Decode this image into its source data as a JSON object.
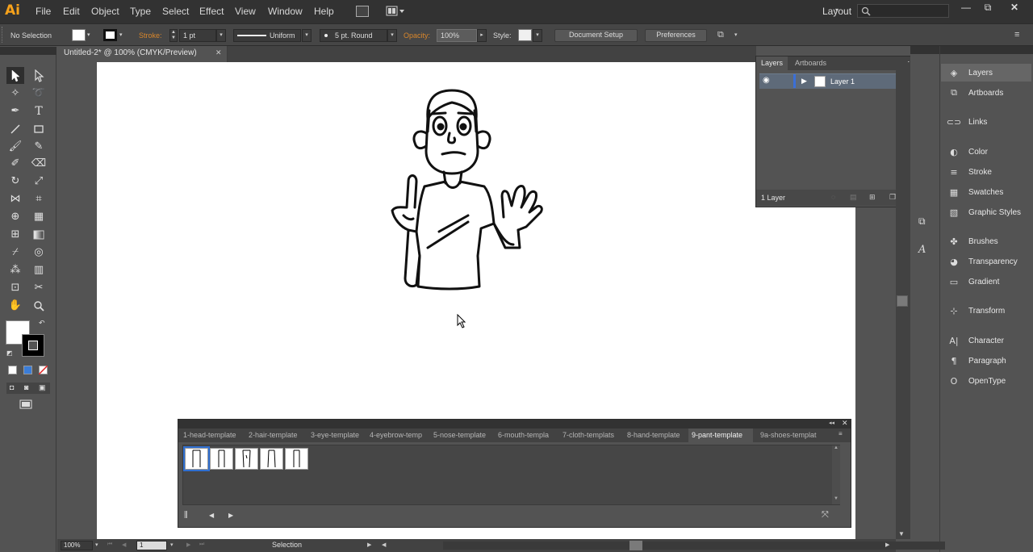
{
  "app": {
    "logo": "Ai"
  },
  "menu": [
    "File",
    "Edit",
    "Object",
    "Type",
    "Select",
    "Effect",
    "View",
    "Window",
    "Help"
  ],
  "workspace": {
    "label": "Layout",
    "search_placeholder": ""
  },
  "control_bar": {
    "selection": "No Selection",
    "stroke_label": "Stroke:",
    "stroke_weight": "1 pt",
    "profile": "Uniform",
    "brush": "5 pt. Round",
    "opacity_label": "Opacity:",
    "opacity": "100%",
    "style_label": "Style:",
    "document_setup": "Document Setup",
    "preferences": "Preferences"
  },
  "document": {
    "tab_title": "Untitled-2* @ 100% (CMYK/Preview)"
  },
  "layers_panel": {
    "tabs": [
      "Layers",
      "Artboards"
    ],
    "active_tab": "Layers",
    "layers": [
      {
        "name": "Layer 1"
      }
    ],
    "count_label": "1 Layer"
  },
  "dock": {
    "items": [
      {
        "label": "Layers",
        "icon": "layers-icon",
        "active": true
      },
      {
        "label": "Artboards",
        "icon": "artboards-icon"
      },
      {
        "label": "Links",
        "icon": "links-icon"
      },
      {
        "label": "Color",
        "icon": "color-icon"
      },
      {
        "label": "Stroke",
        "icon": "stroke-icon"
      },
      {
        "label": "Swatches",
        "icon": "swatches-icon"
      },
      {
        "label": "Graphic Styles",
        "icon": "graphic-styles-icon"
      },
      {
        "label": "Brushes",
        "icon": "brushes-icon"
      },
      {
        "label": "Transparency",
        "icon": "transparency-icon"
      },
      {
        "label": "Gradient",
        "icon": "gradient-icon"
      },
      {
        "label": "Transform",
        "icon": "transform-icon"
      },
      {
        "label": "Character",
        "icon": "character-icon"
      },
      {
        "label": "Paragraph",
        "icon": "paragraph-icon"
      },
      {
        "label": "OpenType",
        "icon": "opentype-icon"
      }
    ]
  },
  "template_panel": {
    "tabs": [
      "1-head-template",
      "2-hair-template",
      "3-eye-template",
      "4-eyebrow-temp",
      "5-nose-template",
      "6-mouth-templa",
      "7-cloth-templats",
      "8-hand-template",
      "9-pant-template",
      "9a-shoes-templat"
    ],
    "active_tab": "9-pant-template",
    "symbol_count": 5
  },
  "status_bar": {
    "zoom": "100%",
    "artboard_number": "1",
    "tool": "Selection"
  }
}
